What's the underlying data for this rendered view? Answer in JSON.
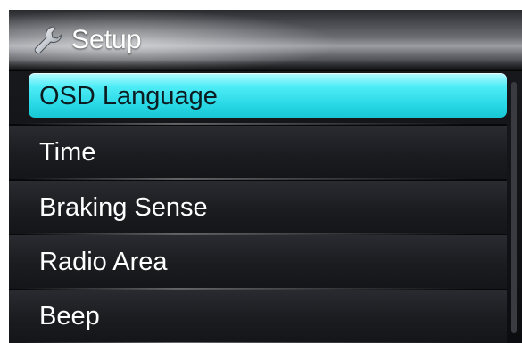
{
  "header": {
    "title": "Setup",
    "icon": "wrench-icon"
  },
  "menu": {
    "selected_index": 0,
    "items": [
      {
        "label": "OSD Language"
      },
      {
        "label": "Time"
      },
      {
        "label": "Braking Sense"
      },
      {
        "label": "Radio Area"
      },
      {
        "label": "Beep"
      }
    ]
  },
  "colors": {
    "highlight": "#2ad9e6",
    "background": "#141519",
    "text": "#ffffff"
  }
}
